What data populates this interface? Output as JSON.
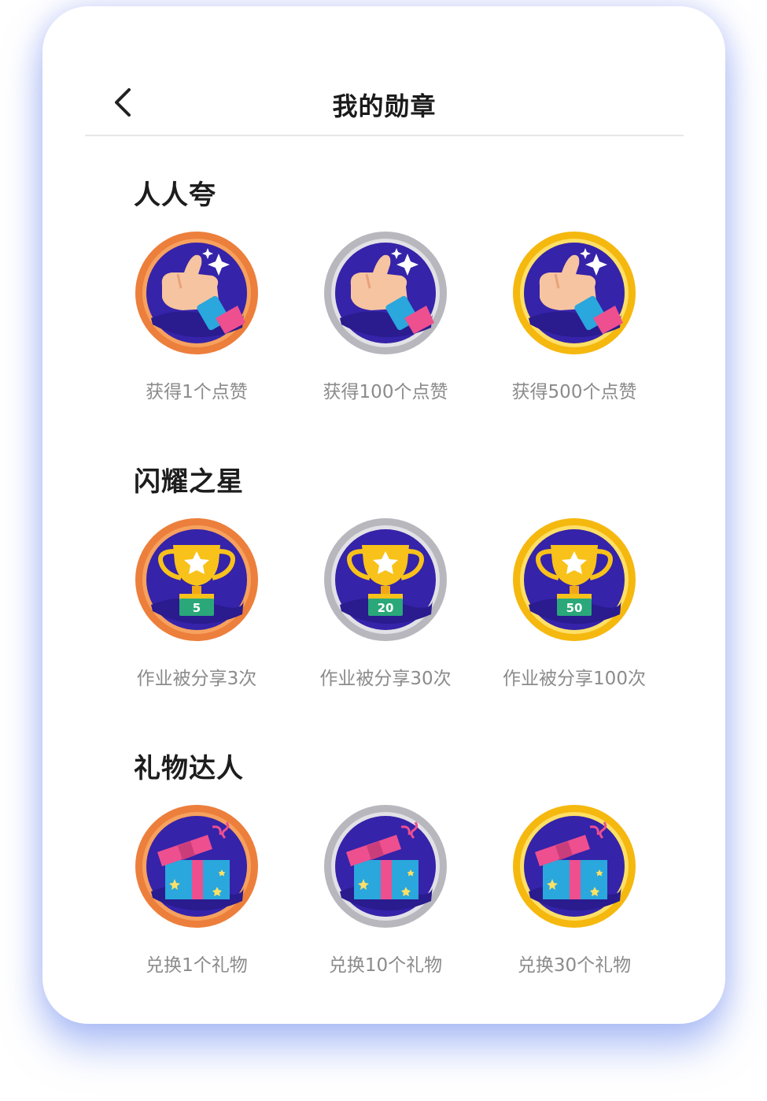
{
  "header": {
    "title": "我的勋章",
    "back_icon": "chevron-left-icon"
  },
  "colors": {
    "bronze": "#EC7F3C",
    "silver": "#BDBDC2",
    "gold": "#F9C51B",
    "medal_inner": "#3523A9",
    "shadow": "#8FA7F4"
  },
  "sections": [
    {
      "title": "人人夸",
      "icon": "thumbs-up-icon",
      "badges": [
        {
          "tier": "bronze",
          "label": "获得1个点赞"
        },
        {
          "tier": "silver",
          "label": "获得100个点赞"
        },
        {
          "tier": "gold",
          "label": "获得500个点赞"
        }
      ]
    },
    {
      "title": "闪耀之星",
      "icon": "trophy-icon",
      "badges": [
        {
          "tier": "bronze",
          "label": "作业被分享3次",
          "number": "5"
        },
        {
          "tier": "silver",
          "label": "作业被分享30次",
          "number": "20"
        },
        {
          "tier": "gold",
          "label": "作业被分享100次",
          "number": "50"
        }
      ]
    },
    {
      "title": "礼物达人",
      "icon": "gift-box-icon",
      "badges": [
        {
          "tier": "bronze",
          "label": "兑换1个礼物"
        },
        {
          "tier": "silver",
          "label": "兑换10个礼物"
        },
        {
          "tier": "gold",
          "label": "兑换30个礼物"
        }
      ]
    }
  ]
}
